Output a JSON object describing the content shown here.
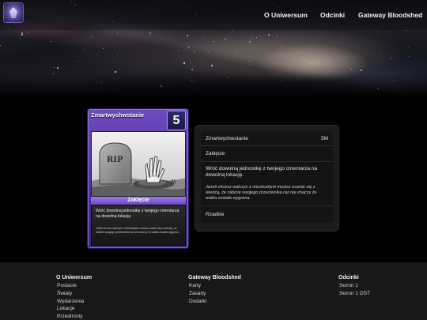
{
  "nav": {
    "links": [
      "O Uniwersum",
      "Odcinki",
      "Gateway Bloodshed"
    ]
  },
  "card": {
    "name": "Zmartwychwstanie",
    "cost": "5",
    "type": "Zaklęcie",
    "effect": "Wróć dowolną jednostkę z twojego cmentarza na dowolną lokację.",
    "flavor": "Jeżeli chcesz walczyć z nieumarłymi musisz oswoić się z wiedzą, że zabicie swojego przeciwnika raz nie znaczy że walka została wygrana.",
    "art_text": "RIP"
  },
  "details": {
    "title": "Zmartwychwstanie",
    "cost": "5M",
    "type": "Zaklęcie",
    "effect": "Wróć dowolną jednostkę z twojego cmentarza na dowolną lokację.",
    "flavor": "Jeżeli chcesz walczyć z nieumarłymi musisz oswoić się z wiedzą, że zabicie swojego przeciwnika raz nie znaczy że walka została wygrana.",
    "rarity": "Rzadkie"
  },
  "footer": {
    "columns": [
      {
        "heading": "O Uniwersum",
        "links": [
          "Postacie",
          "Światy",
          "Wydarzenia",
          "Lokacje",
          "Przedmioty"
        ]
      },
      {
        "heading": "Gateway Bloodshed",
        "links": [
          "Karty",
          "Zasady",
          "Dodatki"
        ]
      },
      {
        "heading": "Odcinki",
        "links": [
          "Sezon 1",
          "Sezon 1 OST"
        ]
      }
    ]
  },
  "colors": {
    "card_purple": "#4b2e98",
    "panel_bg": "#1c1c1e",
    "footer_bg": "#181818"
  },
  "icons": {
    "logo": "gateway-crystal-logo"
  }
}
